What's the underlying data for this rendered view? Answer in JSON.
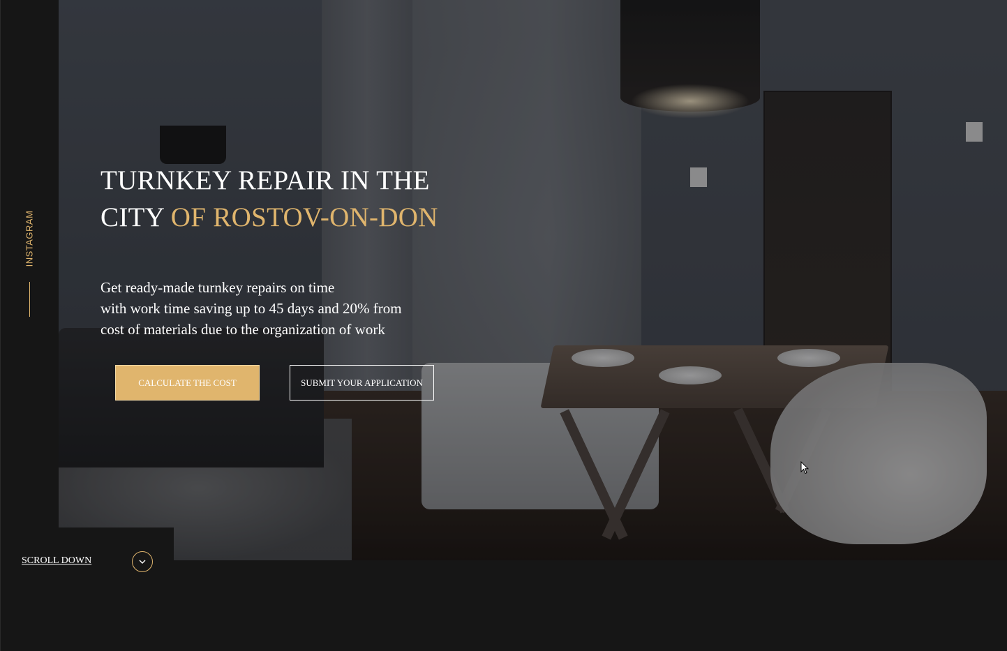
{
  "sidebar": {
    "instagram_label": "INSTAGRAM"
  },
  "hero": {
    "headline_line1": "TURNKEY REPAIR IN THE",
    "headline_line2_white": "CITY ",
    "headline_line2_accent": "OF ROSTOV-ON-DON",
    "subtext_lines": [
      "Get ready-made turnkey repairs on time",
      "with work time saving up to 45 days and 20% from",
      "cost of materials due to the organization of work"
    ],
    "buttons": {
      "calculate_label": "CALCULATE THE COST",
      "submit_label": "SUBMIT YOUR APPLICATION"
    }
  },
  "scroll": {
    "label": "SCROLL DOWN",
    "icon": "chevron-down-icon"
  },
  "colors": {
    "accent": "#e0b56d",
    "background": "#161616",
    "text": "#ffffff"
  }
}
